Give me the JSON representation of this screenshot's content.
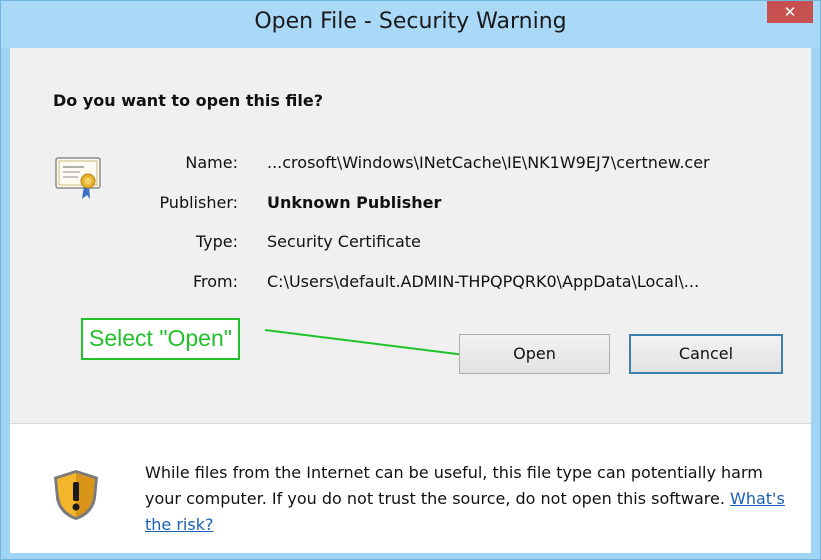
{
  "window": {
    "title": "Open File - Security Warning",
    "close_label": "✕"
  },
  "dialog": {
    "question": "Do you want to open this file?",
    "fields": {
      "name_label": "Name:",
      "name_value": "...crosoft\\Windows\\INetCache\\IE\\NK1W9EJ7\\certnew.cer",
      "publisher_label": "Publisher:",
      "publisher_value": "Unknown Publisher",
      "type_label": "Type:",
      "type_value": "Security Certificate",
      "from_label": "From:",
      "from_value": "C:\\Users\\default.ADMIN-THPQPQRK0\\AppData\\Local\\..."
    },
    "icons": {
      "file": "certificate-icon",
      "warning": "shield-warning-icon"
    }
  },
  "buttons": {
    "open_label": "Open",
    "cancel_label": "Cancel"
  },
  "annotation": {
    "text": "Select \"Open\"",
    "color": "#22c12b"
  },
  "warning": {
    "text": "While files from the Internet can be useful, this file type can potentially harm your computer. If you do not trust the source, do not open this software.",
    "link_text": "What's the risk?"
  },
  "colors": {
    "titlebar": "#a9d9f6",
    "close": "#c75050",
    "link": "#1b5fb5"
  }
}
